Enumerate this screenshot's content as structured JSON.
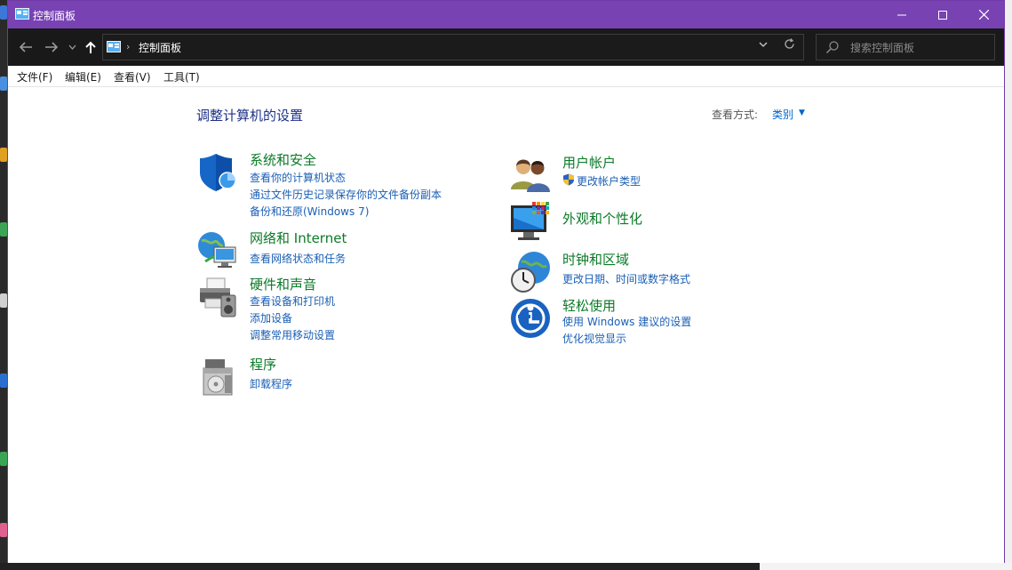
{
  "window": {
    "title": "控制面板",
    "address_path": "控制面板",
    "search_placeholder": "搜索控制面板"
  },
  "menu": {
    "file": "文件(F)",
    "edit": "编辑(E)",
    "view": "查看(V)",
    "tools": "工具(T)"
  },
  "content": {
    "heading": "调整计算机的设置",
    "view_by_label": "查看方式:",
    "view_by_value": "类别"
  },
  "categories": {
    "system_security": {
      "title": "系统和安全",
      "links": [
        "查看你的计算机状态",
        "通过文件历史记录保存你的文件备份副本",
        "备份和还原(Windows 7)"
      ]
    },
    "network": {
      "title": "网络和 Internet",
      "links": [
        "查看网络状态和任务"
      ]
    },
    "hardware": {
      "title": "硬件和声音",
      "links": [
        "查看设备和打印机",
        "添加设备",
        "调整常用移动设置"
      ]
    },
    "programs": {
      "title": "程序",
      "links": [
        "卸载程序"
      ]
    },
    "user_accounts": {
      "title": "用户帐户",
      "links": [
        "更改帐户类型"
      ]
    },
    "appearance": {
      "title": "外观和个性化",
      "links": []
    },
    "clock_region": {
      "title": "时钟和区域",
      "links": [
        "更改日期、时间或数字格式"
      ]
    },
    "ease_of_access": {
      "title": "轻松使用",
      "links": [
        "使用 Windows 建议的设置",
        "优化视觉显示"
      ]
    }
  },
  "colors": {
    "titlebar": "#7842b3",
    "category_title": "#0b7a28",
    "link": "#1a5fb4",
    "heading": "#1e3287"
  }
}
